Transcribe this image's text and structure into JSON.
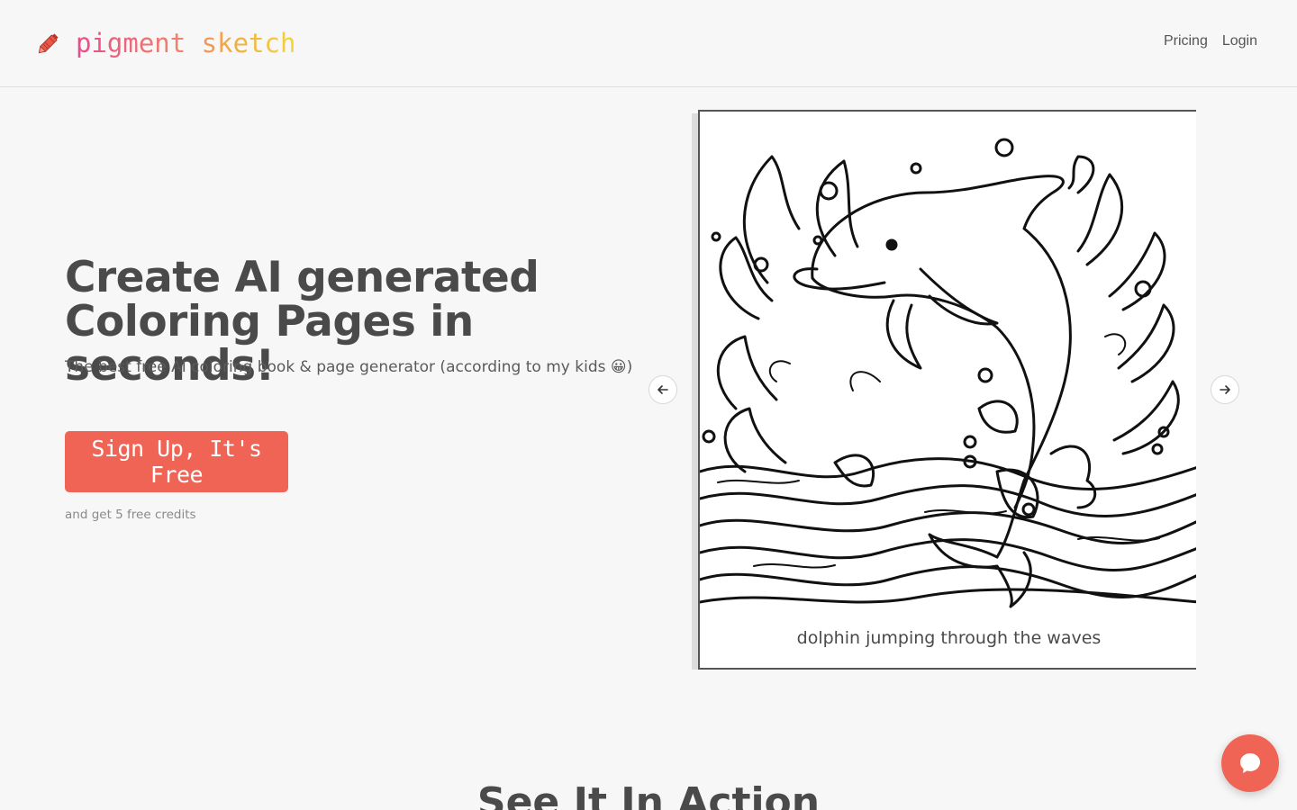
{
  "brand": {
    "name": "pigment sketch",
    "icon": "crayon-icon",
    "gradient": [
      "#e94b8a",
      "#f07f6c",
      "#f2b13f",
      "#f4d43a"
    ]
  },
  "nav": {
    "pricing": "Pricing",
    "login": "Login"
  },
  "hero": {
    "title_line1": "Create AI generated",
    "title_line2": "Coloring Pages in seconds!",
    "subtitle": "The best free AI coloring book & page generator (according to my kids 😀)",
    "cta_label": "Sign Up, It's Free",
    "cta_note": "and get 5 free credits",
    "accent_color": "#ef6455"
  },
  "carousel": {
    "prev_icon": "arrow-left-icon",
    "next_icon": "arrow-right-icon",
    "current_caption": "dolphin jumping through the waves"
  },
  "section": {
    "title": "See It In Action"
  },
  "chat": {
    "icon": "chat-bubble-icon"
  }
}
